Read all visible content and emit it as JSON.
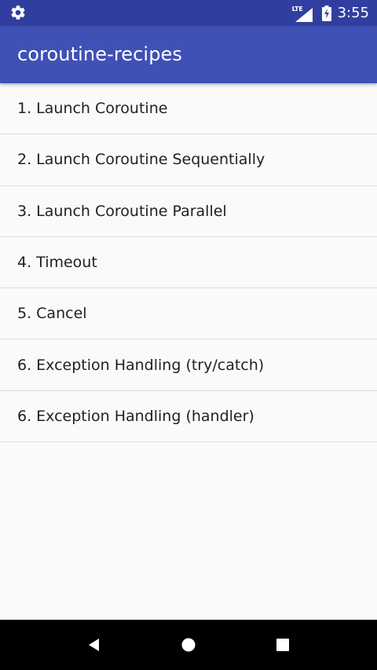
{
  "status_bar": {
    "network_type": "LTE",
    "time": "3:55",
    "icons": [
      "settings-gear-icon",
      "signal-icon",
      "battery-charging-icon"
    ]
  },
  "app_bar": {
    "title": "coroutine-recipes"
  },
  "list": {
    "items": [
      {
        "label": "1. Launch Coroutine"
      },
      {
        "label": "2. Launch Coroutine Sequentially"
      },
      {
        "label": "3. Launch Coroutine Parallel"
      },
      {
        "label": "4. Timeout"
      },
      {
        "label": "5. Cancel"
      },
      {
        "label": "6. Exception Handling (try/catch)"
      },
      {
        "label": "6. Exception Handling (handler)"
      }
    ]
  },
  "nav_bar": {
    "icons": [
      "back-icon",
      "home-icon",
      "recents-icon"
    ]
  },
  "colors": {
    "status_bar": "#303f9f",
    "app_bar": "#3f51b5",
    "background": "#fafafa",
    "divider": "#dcdcdc",
    "text_primary": "#212121",
    "nav_bar": "#000000"
  }
}
